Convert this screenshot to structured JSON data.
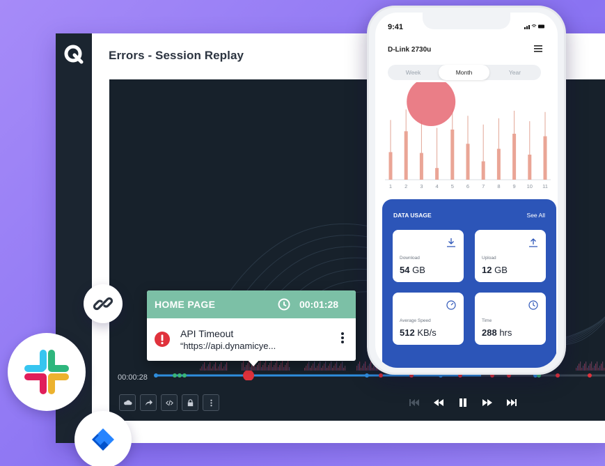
{
  "app": {
    "title": "Errors - Session Replay"
  },
  "timeline": {
    "current_time": "00:00:28",
    "progress_fraction": 0.25
  },
  "popup": {
    "page_name": "HOME PAGE",
    "timestamp": "00:01:28",
    "error_title": "API Timeout",
    "error_url": "“https://api.dynamicye..."
  },
  "phone": {
    "status_time": "9:41",
    "device_name": "D-Link 2730u",
    "tabs": [
      {
        "label": "Week",
        "active": false
      },
      {
        "label": "Month",
        "active": true
      },
      {
        "label": "Year",
        "active": false
      }
    ],
    "data_usage": {
      "title": "DATA USAGE",
      "see_all": "See All",
      "tiles": [
        {
          "label": "Download",
          "value": "54",
          "unit": "GB",
          "icon": "download-icon"
        },
        {
          "label": "Upload",
          "value": "12",
          "unit": "GB",
          "icon": "upload-icon"
        },
        {
          "label": "Average Speed",
          "value": "512",
          "unit": "KB/s",
          "icon": "speedometer-icon"
        },
        {
          "label": "Time",
          "value": "288",
          "unit": "hrs",
          "icon": "clock-icon"
        }
      ]
    }
  },
  "chart_data": {
    "type": "bar",
    "categories": [
      "1",
      "2",
      "3",
      "4",
      "5",
      "6",
      "7",
      "8",
      "9",
      "10",
      "11"
    ],
    "values": [
      33,
      58,
      32,
      14,
      60,
      43,
      22,
      37,
      55,
      30,
      52
    ],
    "highlight_index": 1
  },
  "colors": {
    "accent_blue": "#2c55b8",
    "popup_header": "#7cc0a6",
    "error_red": "#e0323c",
    "bar": "#eaa596",
    "highlight": "#e8707a",
    "player_bg": "#17212b"
  }
}
